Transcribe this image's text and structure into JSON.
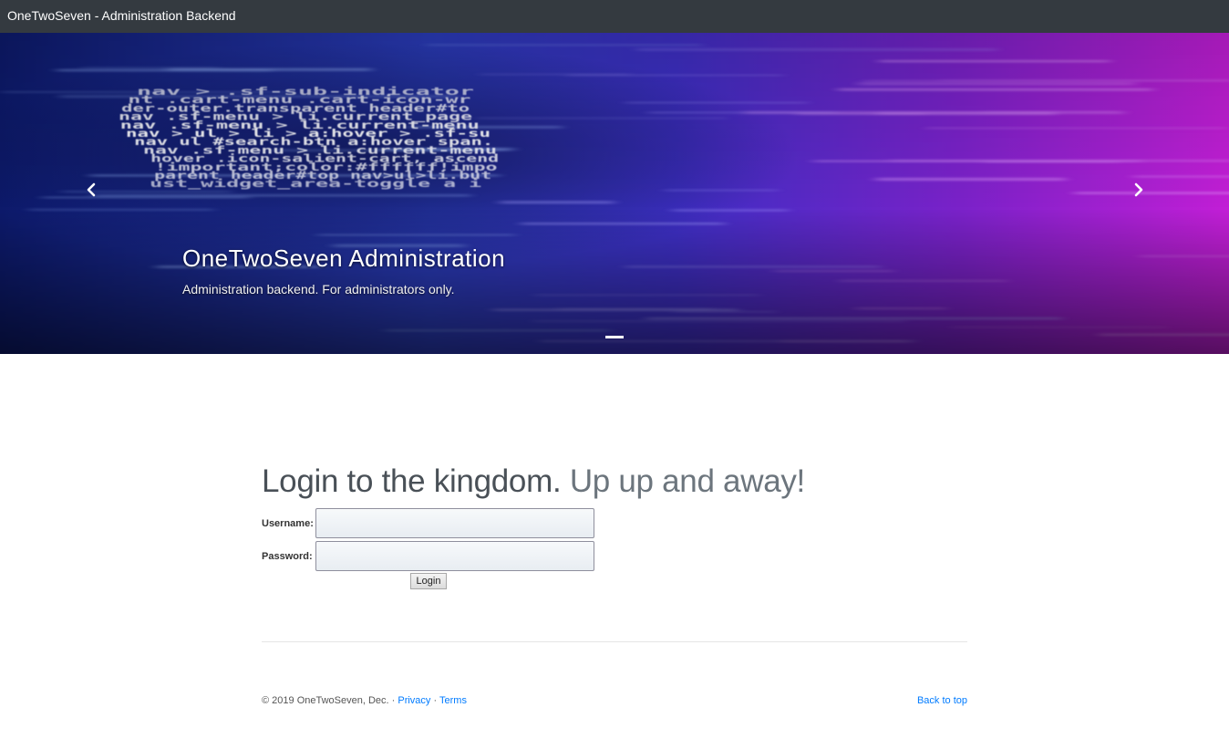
{
  "navbar": {
    "brand": "OneTwoSeven - Administration Backend"
  },
  "carousel": {
    "title": "OneTwoSeven Administration",
    "text": "Administration backend. For administrators only.",
    "code_lines": [
      "nav > .sf-sub-indicator",
      "nt .cart-menu .cart-icon-wr",
      "der-outer.transparent header#to",
      "nav .sf-menu > li.current_page",
      "nav .sf-menu > li.current-menu",
      "nav > ul > li > a:hover > .sf-su",
      "nav ul #search-btn a:hover span.",
      "nav .sf-menu > li.current-menu",
      "hover .icon-salient-cart, ascend",
      "!important;color:#ffffff!impo",
      "parent header#top nav>ul>li.but",
      "ust_widget_area-toggle a i"
    ],
    "colors": {
      "left": "#1a2f9e",
      "middle": "#3b2fc9",
      "right": "#b81bd8"
    }
  },
  "login": {
    "heading_main": "Login to the kingdom.",
    "heading_muted": "Up up and away!",
    "username_label": "Username:",
    "password_label": "Password:",
    "submit_label": "Login"
  },
  "footer": {
    "copyright": "© 2019 OneTwoSeven, Dec. ·",
    "privacy": "Privacy",
    "separator": "·",
    "terms": "Terms",
    "back_to_top": "Back to top"
  }
}
